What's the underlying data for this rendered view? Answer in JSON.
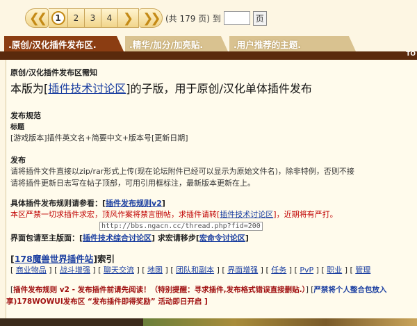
{
  "pager": {
    "first_icon": "double-chevron-left-icon",
    "current": "1",
    "pages": [
      "2",
      "3",
      "4"
    ],
    "next_icon": "chevron-right-icon",
    "last_icon": "double-chevron-right-icon",
    "total_text": "(共 179 页) 到",
    "go_label": "页"
  },
  "tabs": [
    {
      "label": ".原创/汉化插件发布区."
    },
    {
      "label": ".精华/加分/加亮贴."
    },
    {
      "label": ".用户推荐的主题."
    }
  ],
  "topbar_right": "TO",
  "rules": {
    "heading": "原创/汉化插件发布区需知",
    "intro_pre": "本版为[",
    "intro_link": "插件技术讨论区",
    "intro_post": "]的子版，用于原创/汉化单体插件发布",
    "spec_heading": "发布规范",
    "title_label": "标题",
    "title_format": "[游戏版本]插件英文名+简要中文+版本号[更新日期]",
    "publish_label": "发布",
    "publish_line1": "请将插件文件直接以zip/rar形式上传(现在论坛附件已经可以显示为原始文件名)，除非特例，否则不接",
    "publish_line2": "请将插件更新日志写在帖子顶部，可用引用框标注，最新版本更新在上。",
    "detail_pre": "具体插件发布规则请参看：[",
    "detail_link": "插件发布规则v2",
    "detail_post": "]",
    "red_pre": "本区严禁一切求插件求宏，顶风作案将禁言删帖，求插件请转[",
    "red_link": "插件技术讨论区",
    "red_post": "]，近期将有严打。",
    "tooltip": "http://bbs.ngacn.cc/thread.php?fid=200",
    "board_pre": "界面包请至主版面：[",
    "board_link": "插件技术综合讨论区",
    "board_mid": "] 求宏请移步[",
    "board_link2": "宏命令讨论区",
    "board_post": "]",
    "index_pre": "[",
    "index_link": "178魔兽世界插件站",
    "index_post": "]索引",
    "categories": [
      "商业物品",
      "战斗增强",
      "聊天交流",
      "地图",
      "团队和副本",
      "界面增强",
      "任务",
      "PvP",
      "职业",
      "管理"
    ],
    "notice_pre": "[",
    "notice_link": "插件发布规则 v2 - 发布插件前请先阅读！（特别提醒：寻求插件,发布格式错误直接删贴.）",
    "notice_mid": "] [",
    "notice_link2": "严禁将个人整合包放入",
    "notice_line2": "享)178WOWUI发布区 “发布插件即得奖励” 活动即日开启 ]"
  },
  "colors": {
    "tab_active": "#8b3d12",
    "tab_inactive": "#d9c290",
    "background": "#fdf6e3",
    "link": "#1a3ea0",
    "warning": "#c00000"
  }
}
